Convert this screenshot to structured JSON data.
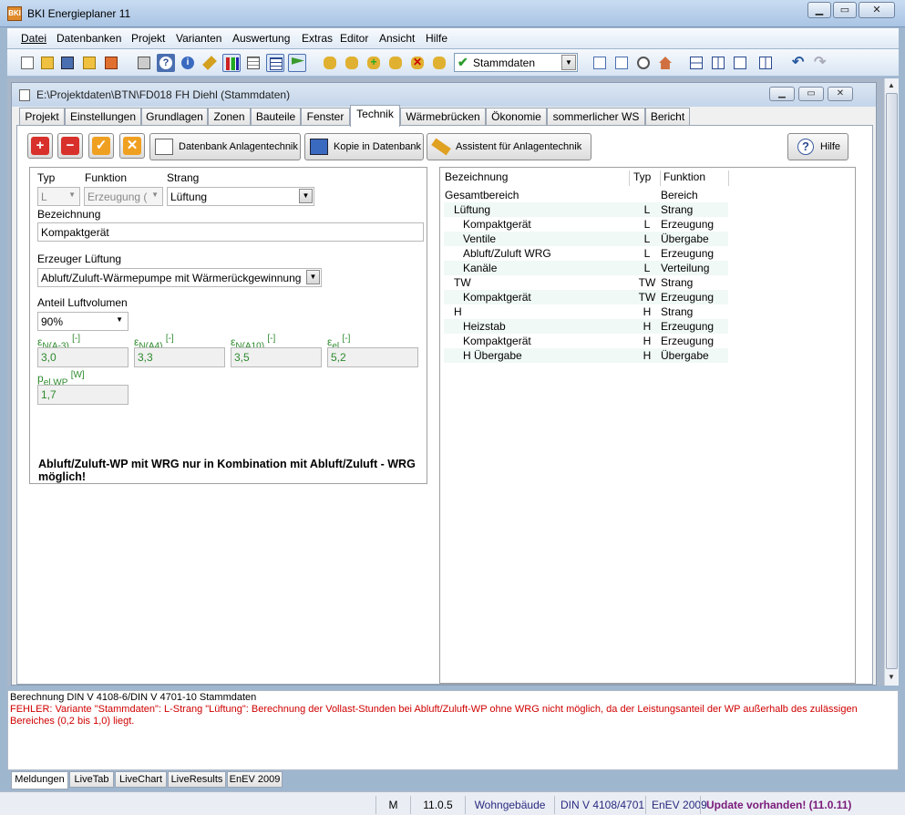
{
  "window": {
    "title": "BKI Energieplaner 11",
    "icon_text": "BKI"
  },
  "menu": [
    "Datei",
    "Datenbanken",
    "Projekt",
    "Varianten",
    "Auswertung",
    "Extras",
    "Editor",
    "Ansicht",
    "Hilfe"
  ],
  "toolbar": {
    "variant_select": "Stammdaten"
  },
  "document": {
    "path": "E:\\Projektdaten\\BTN\\FD018 FH Diehl (Stammdaten)"
  },
  "tabs": [
    "Projekt",
    "Einstellungen",
    "Grundlagen",
    "Zonen",
    "Bauteile",
    "Fenster",
    "Technik",
    "Wärmebrücken",
    "Ökonomie",
    "sommerlicher WS",
    "Bericht"
  ],
  "active_tab": "Technik",
  "actions": {
    "db_anlagentechnik": "Datenbank Anlagentechnik",
    "kopie_db": "Kopie in Datenbank",
    "assistent": "Assistent für Anlagentechnik",
    "hilfe": "Hilfe"
  },
  "form": {
    "typ_label": "Typ",
    "typ_value": "L",
    "funktion_label": "Funktion",
    "funktion_value": "Erzeugung (",
    "strang_label": "Strang",
    "strang_value": "Lüftung",
    "bezeichnung_label": "Bezeichnung",
    "bezeichnung_value": "Kompaktgerät",
    "erzeuger_label": "Erzeuger Lüftung",
    "erzeuger_value": "Abluft/Zuluft-Wärmepumpe mit Wärmerückgewinnung",
    "anteil_label": "Anteil Luftvolumen",
    "anteil_value": "90%",
    "eps_a3_sym": "ε",
    "eps_a3_sub": "N(A-3)",
    "eps_a3_unit": "[-]",
    "eps_a3_value": "3,0",
    "eps_a4_sym": "ε",
    "eps_a4_sub": "N(A4)",
    "eps_a4_unit": "[-]",
    "eps_a4_value": "3,3",
    "eps_a10_sym": "ε",
    "eps_a10_sub": "N(A10)",
    "eps_a10_unit": "[-]",
    "eps_a10_value": "3,5",
    "eps_el_sym": "ε",
    "eps_el_sub": "el",
    "eps_el_unit": "[-]",
    "eps_el_value": "5,2",
    "p_sym": "p",
    "p_sub": "el,WP",
    "p_unit": "[W]",
    "p_value": "1,7",
    "warning": "Abluft/Zuluft-WP mit WRG nur in Kombination mit Abluft/Zuluft - WRG möglich!"
  },
  "tree": {
    "headers": [
      "Bezeichnung",
      "Typ",
      "Funktion"
    ],
    "rows": [
      {
        "name": "Gesamtbereich",
        "typ": "",
        "funktion": "Bereich"
      },
      {
        "name": "Lüftung",
        "typ": "L",
        "funktion": "Strang"
      },
      {
        "name": "Kompaktgerät",
        "typ": "L",
        "funktion": "Erzeugung"
      },
      {
        "name": "Ventile",
        "typ": "L",
        "funktion": "Übergabe"
      },
      {
        "name": "Abluft/Zuluft WRG",
        "typ": "L",
        "funktion": "Erzeugung"
      },
      {
        "name": "Kanäle",
        "typ": "L",
        "funktion": "Verteilung"
      },
      {
        "name": "TW",
        "typ": "TW",
        "funktion": "Strang"
      },
      {
        "name": "Kompaktgerät",
        "typ": "TW",
        "funktion": "Erzeugung"
      },
      {
        "name": "H",
        "typ": "H",
        "funktion": "Strang"
      },
      {
        "name": "Heizstab",
        "typ": "H",
        "funktion": "Erzeugung"
      },
      {
        "name": "Kompaktgerät",
        "typ": "H",
        "funktion": "Erzeugung"
      },
      {
        "name": "H Übergabe",
        "typ": "H",
        "funktion": "Übergabe"
      }
    ]
  },
  "messages": {
    "info": "Berechnung DIN V 4108-6/DIN V 4701-10 Stammdaten",
    "error": "FEHLER: Variante \"Stammdaten\": L-Strang \"Lüftung\": Berechnung der Vollast-Stunden bei Abluft/Zuluft-WP ohne WRG nicht möglich, da der Leistungsanteil der WP außerhalb des zulässigen Bereiches (0,2 bis 1,0) liegt."
  },
  "bottom_tabs": [
    "Meldungen",
    "LiveTab",
    "LiveChart",
    "LiveResults",
    "EnEV 2009"
  ],
  "status": {
    "mode": "M",
    "version": "11.0.5",
    "building": "Wohngebäude",
    "norm": "DIN V 4108/4701",
    "enev": "EnEV 2009",
    "update": "Update vorhanden! (11.0.11)"
  }
}
